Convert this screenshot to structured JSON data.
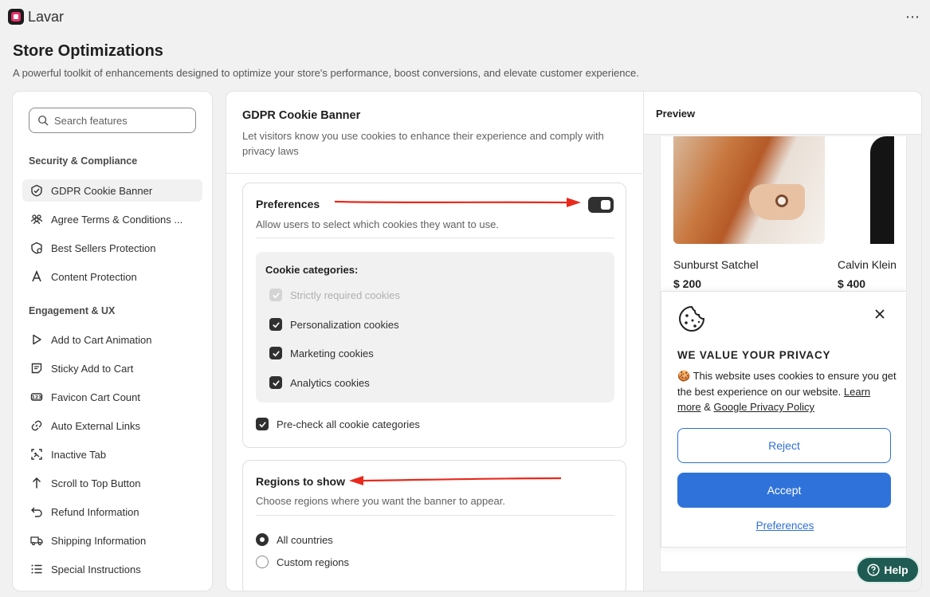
{
  "app": {
    "name": "Lavar",
    "more": "⋯"
  },
  "page": {
    "title": "Store Optimizations",
    "subtitle": "A powerful toolkit of enhancements designed to optimize your store's performance, boost conversions, and elevate customer experience."
  },
  "sidebar": {
    "search_placeholder": "Search features",
    "sections": [
      {
        "title": "Security & Compliance"
      },
      {
        "title": "Engagement & UX"
      }
    ],
    "items": [
      {
        "label": "GDPR Cookie Banner",
        "icon": "shield-check-icon",
        "active": true
      },
      {
        "label": "Agree Terms & Conditions ...",
        "icon": "people-icon"
      },
      {
        "label": "Best Sellers Protection",
        "icon": "shield-badge-icon"
      },
      {
        "label": "Content Protection",
        "icon": "text-a-icon"
      },
      {
        "label": "Add to Cart Animation",
        "icon": "play-icon"
      },
      {
        "label": "Sticky Add to Cart",
        "icon": "note-icon"
      },
      {
        "label": "Favicon Cart Count",
        "icon": "counter-icon"
      },
      {
        "label": "Auto External Links",
        "icon": "link-icon"
      },
      {
        "label": "Inactive Tab",
        "icon": "tab-icon"
      },
      {
        "label": "Scroll to Top Button",
        "icon": "arrow-up-icon"
      },
      {
        "label": "Refund Information",
        "icon": "undo-icon"
      },
      {
        "label": "Shipping Information",
        "icon": "truck-icon"
      },
      {
        "label": "Special Instructions",
        "icon": "list-icon"
      }
    ]
  },
  "gdpr": {
    "title": "GDPR Cookie Banner",
    "description": "Let visitors know you use cookies to enhance their experience and comply with privacy laws",
    "preferences": {
      "title": "Preferences",
      "description": "Allow users to select which cookies they want to use.",
      "enabled": true,
      "categories_title": "Cookie categories:",
      "categories": [
        {
          "label": "Strictly required cookies",
          "checked": true,
          "disabled": true
        },
        {
          "label": "Personalization cookies",
          "checked": true
        },
        {
          "label": "Marketing cookies",
          "checked": true
        },
        {
          "label": "Analytics cookies",
          "checked": true
        }
      ],
      "precheck_label": "Pre-check all cookie categories",
      "precheck_checked": true
    },
    "regions": {
      "title": "Regions to show",
      "description": "Choose regions where you want the banner to appear.",
      "options": [
        {
          "label": "All countries",
          "selected": true
        },
        {
          "label": "Custom regions",
          "selected": false
        }
      ]
    }
  },
  "preview": {
    "title": "Preview",
    "products": [
      {
        "name": "Sunburst Satchel",
        "price": "$ 200"
      },
      {
        "name": "Calvin Klein",
        "price": "$ 400"
      }
    ],
    "banner": {
      "title": "WE VALUE YOUR PRIVACY",
      "text": "🍪 This website uses cookies to ensure you get the best experience on our website.",
      "learn_more": "Learn more",
      "amp": "&",
      "privacy_link": "Google Privacy Policy",
      "reject": "Reject",
      "accept": "Accept",
      "preferences": "Preferences"
    }
  },
  "help": {
    "label": "Help"
  },
  "colors": {
    "accent": "#2f73da",
    "annotation_arrow": "#e8291c",
    "help": "#1f5b52"
  }
}
